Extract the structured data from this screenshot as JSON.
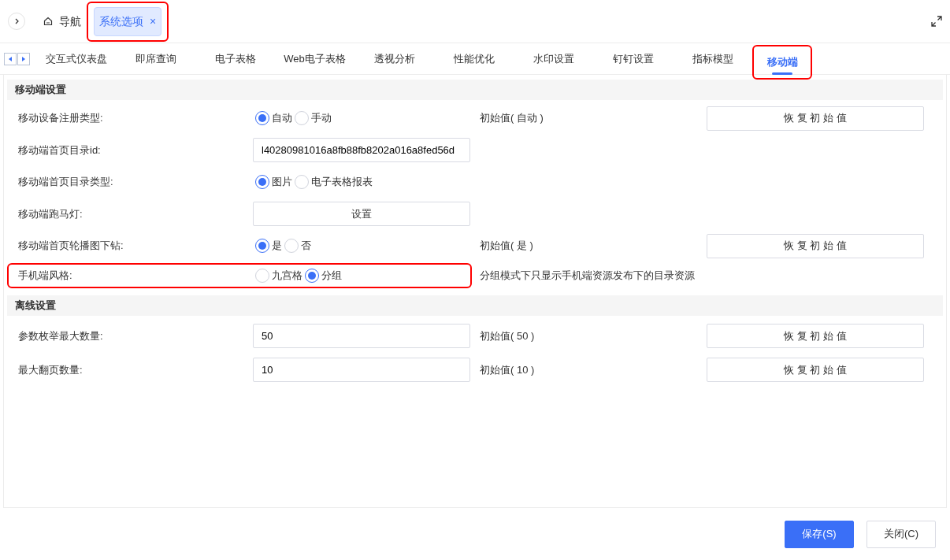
{
  "top_tabs": [
    {
      "label": "导航",
      "kind": "home",
      "selected": false,
      "closable": false,
      "highlighted": false
    },
    {
      "label": "系统选项",
      "kind": "page",
      "selected": true,
      "closable": true,
      "highlighted": true
    }
  ],
  "close_glyph": "×",
  "sub_tabs": [
    {
      "label": "交互式仪表盘",
      "selected": false,
      "highlighted": false
    },
    {
      "label": "即席查询",
      "selected": false,
      "highlighted": false
    },
    {
      "label": "电子表格",
      "selected": false,
      "highlighted": false
    },
    {
      "label": "Web电子表格",
      "selected": false,
      "highlighted": false
    },
    {
      "label": "透视分析",
      "selected": false,
      "highlighted": false
    },
    {
      "label": "性能优化",
      "selected": false,
      "highlighted": false
    },
    {
      "label": "水印设置",
      "selected": false,
      "highlighted": false
    },
    {
      "label": "钉钉设置",
      "selected": false,
      "highlighted": false
    },
    {
      "label": "指标模型",
      "selected": false,
      "highlighted": false
    },
    {
      "label": "移动端",
      "selected": true,
      "highlighted": true
    }
  ],
  "sections": [
    {
      "title": "移动端设置",
      "rows": [
        {
          "label": "移动设备注册类型:",
          "kind": "radio",
          "highlighted": false,
          "options": [
            {
              "label": "自动",
              "selected": true
            },
            {
              "label": "手动",
              "selected": false
            }
          ],
          "initial": "初始值( 自动 )",
          "reset": "恢 复 初 始 值"
        },
        {
          "label": "移动端首页目录id:",
          "kind": "input",
          "highlighted": false,
          "value": "l40280981016a8fb88fb8202a016a8fed56d"
        },
        {
          "label": "移动端首页目录类型:",
          "kind": "radio",
          "highlighted": false,
          "options": [
            {
              "label": "图片",
              "selected": true
            },
            {
              "label": "电子表格报表",
              "selected": false
            }
          ]
        },
        {
          "label": "移动端跑马灯:",
          "kind": "button",
          "highlighted": false,
          "button": "设置"
        },
        {
          "label": "移动端首页轮播图下钻:",
          "kind": "radio",
          "highlighted": false,
          "options": [
            {
              "label": "是",
              "selected": true
            },
            {
              "label": "否",
              "selected": false
            }
          ],
          "initial": "初始值( 是 )",
          "reset": "恢 复 初 始 值"
        },
        {
          "label": "手机端风格:",
          "kind": "radio",
          "highlighted": true,
          "options": [
            {
              "label": "九宫格",
              "selected": false
            },
            {
              "label": "分组",
              "selected": true
            }
          ],
          "note": "分组模式下只显示手机端资源发布下的目录资源"
        }
      ]
    },
    {
      "title": "离线设置",
      "rows": [
        {
          "label": "参数枚举最大数量:",
          "kind": "input",
          "highlighted": false,
          "value": "50",
          "initial": "初始值( 50 )",
          "reset": "恢 复 初 始 值"
        },
        {
          "label": "最大翻页数量:",
          "kind": "input",
          "highlighted": false,
          "value": "10",
          "initial": "初始值( 10 )",
          "reset": "恢 复 初 始 值"
        }
      ]
    }
  ],
  "footer": [
    {
      "label": "保存(S)",
      "primary": true
    },
    {
      "label": "关闭(C)",
      "primary": false
    }
  ]
}
